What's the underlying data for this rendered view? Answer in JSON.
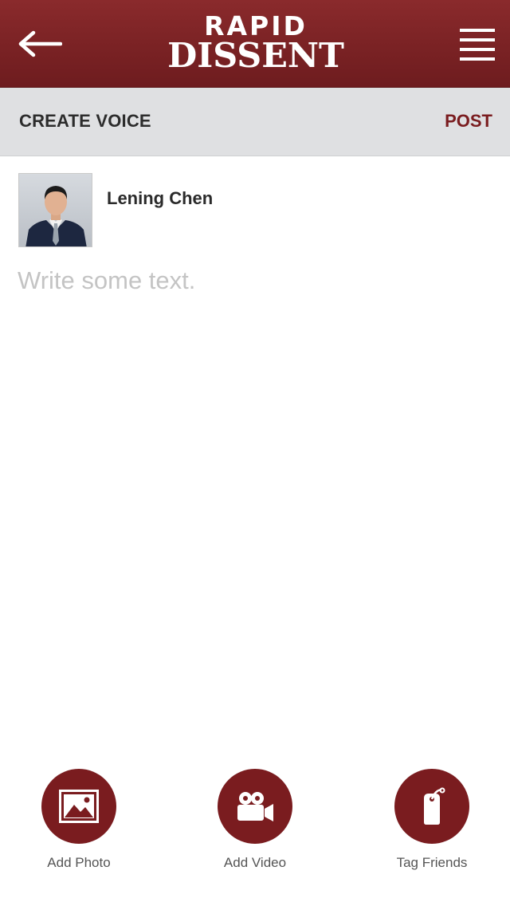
{
  "header": {
    "logo_line1": "RAPID",
    "logo_line2": "DISSENT",
    "back_icon": "arrow-left-icon",
    "menu_icon": "hamburger-menu-icon",
    "brand_color": "#7a2224"
  },
  "subbar": {
    "title": "CREATE VOICE",
    "post_label": "POST",
    "post_color": "#7a1c1f"
  },
  "user": {
    "name": "Lening Chen",
    "avatar": "profile-photo"
  },
  "composer": {
    "placeholder": "Write some text.",
    "value": ""
  },
  "actions": [
    {
      "label": "Add Photo",
      "icon": "image-icon"
    },
    {
      "label": "Add Video",
      "icon": "video-camera-icon"
    },
    {
      "label": "Tag Friends",
      "icon": "tag-icon"
    }
  ]
}
